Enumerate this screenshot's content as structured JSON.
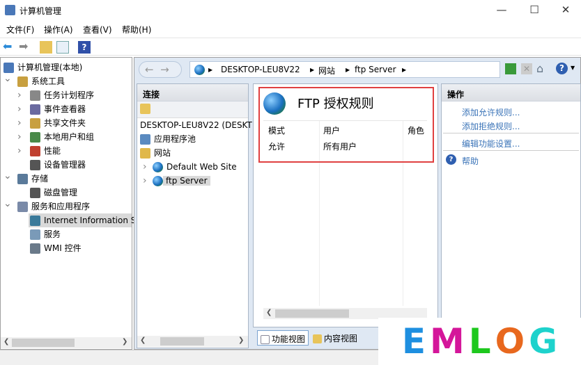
{
  "window": {
    "title": "计算机管理",
    "minimize": "—",
    "maximize": "☐",
    "close": "✕"
  },
  "menu": [
    "文件(F)",
    "操作(A)",
    "查看(V)",
    "帮助(H)"
  ],
  "tree": [
    {
      "label": "计算机管理(本地)",
      "level": 0
    },
    {
      "label": "系统工具",
      "level": 1,
      "expanded": true
    },
    {
      "label": "任务计划程序",
      "level": 2
    },
    {
      "label": "事件查看器",
      "level": 2
    },
    {
      "label": "共享文件夹",
      "level": 2
    },
    {
      "label": "本地用户和组",
      "level": 2
    },
    {
      "label": "性能",
      "level": 2
    },
    {
      "label": "设备管理器",
      "level": 2
    },
    {
      "label": "存储",
      "level": 1,
      "expanded": true
    },
    {
      "label": "磁盘管理",
      "level": 2
    },
    {
      "label": "服务和应用程序",
      "level": 1,
      "expanded": true
    },
    {
      "label": "Internet Information S",
      "level": 2,
      "selected": true
    },
    {
      "label": "服务",
      "level": 2
    },
    {
      "label": "WMI 控件",
      "level": 2
    }
  ],
  "address": {
    "crumbs": [
      "DESKTOP-LEU8V22",
      "网站",
      "ftp Server"
    ]
  },
  "connections": {
    "title": "连接",
    "items": [
      {
        "label": "DESKTOP-LEU8V22 (DESKT"
      },
      {
        "label": "应用程序池"
      },
      {
        "label": "网站"
      },
      {
        "label": "Default Web Site"
      },
      {
        "label": "ftp Server",
        "selected": true
      }
    ]
  },
  "feature": {
    "title": "FTP 授权规则",
    "columns": [
      "模式",
      "用户",
      "角色"
    ],
    "rows": [
      [
        "允许",
        "所有用户",
        ""
      ]
    ]
  },
  "view_tabs": [
    "功能视图",
    "内容视图"
  ],
  "actions": {
    "title": "操作",
    "links": [
      "添加允许规则...",
      "添加拒绝规则...",
      "编辑功能设置...",
      "帮助"
    ]
  },
  "watermark": {
    "text": "EMLOG",
    "colors": [
      "#1e8fe0",
      "#d4169a",
      "#1ec81e",
      "#e8681e",
      "#1ed2cc"
    ]
  }
}
